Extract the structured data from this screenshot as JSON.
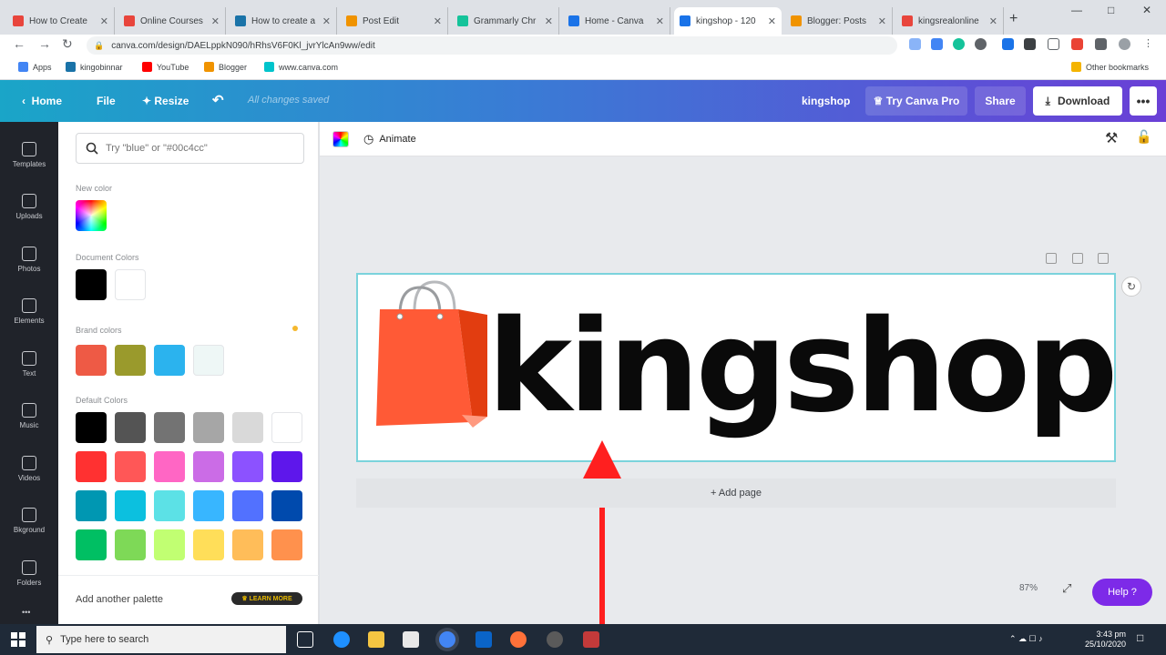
{
  "browser": {
    "tabs": [
      {
        "title": "How to Create",
        "color": "#e8453c"
      },
      {
        "title": "Online Courses",
        "color": "#e8453c"
      },
      {
        "title": "How to create a",
        "color": "#1a73a8"
      },
      {
        "title": "Post Edit",
        "color": "#f09300"
      },
      {
        "title": "Grammarly Chr",
        "color": "#15c39a"
      },
      {
        "title": "Home - Canva",
        "color": "#1a73e8"
      },
      {
        "title": "kingshop - 120",
        "color": "#1a73e8",
        "active": true
      },
      {
        "title": "Blogger: Posts",
        "color": "#f09300"
      },
      {
        "title": "kingsrealonline",
        "color": "#e8453c"
      }
    ],
    "new_tab": "+",
    "url": "canva.com/design/DAELppkN090/hRhsV6F0Kl_jvrYlcAn9ww/edit",
    "bookmarks": [
      {
        "label": "Apps",
        "color": "#4285f4"
      },
      {
        "label": "kingobinnar",
        "color": "#1a73a8"
      },
      {
        "label": "YouTube",
        "color": "#ff0000"
      },
      {
        "label": "Blogger",
        "color": "#f09300"
      },
      {
        "label": "www.canva.com",
        "color": "#00c4cc"
      }
    ],
    "other_bookmarks": "Other bookmarks"
  },
  "header": {
    "home": "Home",
    "file": "File",
    "resize": "Resize",
    "saved": "All changes saved",
    "design_name": "kingshop",
    "try_pro": "Try Canva Pro",
    "share": "Share",
    "download": "Download",
    "more": "•••"
  },
  "sidebar": {
    "items": [
      {
        "label": "Templates",
        "icon": "templates-icon"
      },
      {
        "label": "Uploads",
        "icon": "uploads-icon"
      },
      {
        "label": "Photos",
        "icon": "photos-icon"
      },
      {
        "label": "Elements",
        "icon": "elements-icon"
      },
      {
        "label": "Text",
        "icon": "text-icon"
      },
      {
        "label": "Music",
        "icon": "music-icon"
      },
      {
        "label": "Videos",
        "icon": "videos-icon"
      },
      {
        "label": "Bkground",
        "icon": "background-icon"
      },
      {
        "label": "Folders",
        "icon": "folders-icon"
      }
    ],
    "more": "•••"
  },
  "color_panel": {
    "search_placeholder": "Try \"blue\" or \"#00c4cc\"",
    "new_color_label": "New color",
    "document_colors_label": "Document Colors",
    "document_colors": [
      "#000000",
      "#ffffff"
    ],
    "brand_colors_label": "Brand colors",
    "brand_colors": [
      "#ee5a45",
      "#9a9a2c",
      "#2bb3ee",
      "#eef7f6"
    ],
    "default_colors_label": "Default Colors",
    "default_colors": [
      [
        "#000000",
        "#545454",
        "#737373",
        "#a6a6a6",
        "#d9d9d9",
        "#ffffff"
      ],
      [
        "#ff3131",
        "#ff5757",
        "#ff66c4",
        "#cb6ce6",
        "#8c52ff",
        "#5e17eb"
      ],
      [
        "#0097b2",
        "#0cc0df",
        "#5ce1e6",
        "#38b6ff",
        "#5271ff",
        "#004aad"
      ],
      [
        "#00bf63",
        "#7ed957",
        "#c1ff72",
        "#ffde59",
        "#ffbd59",
        "#ff914d"
      ]
    ],
    "add_palette": "Add another palette",
    "learn_more": "LEARN MORE"
  },
  "editor": {
    "animate": "Animate",
    "design_text": "kingshop",
    "add_page": "+ Add page",
    "zoom": "87%",
    "help": "Help ?"
  },
  "taskbar": {
    "search_placeholder": "Type here to search",
    "time": "3:43 pm",
    "date": "25/10/2020"
  }
}
